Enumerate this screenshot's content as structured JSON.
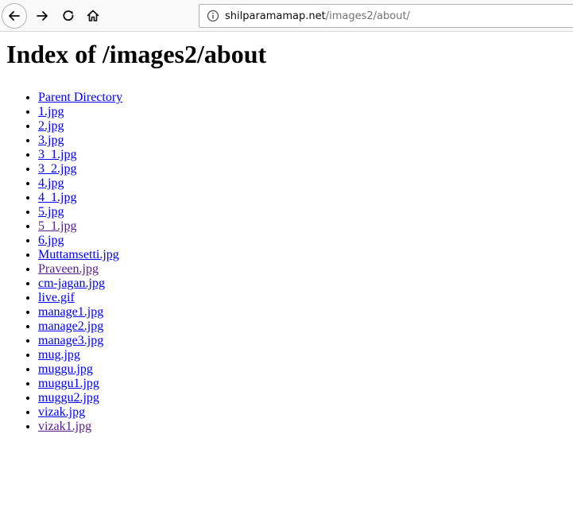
{
  "browser": {
    "url_host": "shilparamamap.net",
    "url_path": "/images2/about/",
    "icons": {
      "back": "arrow-left-icon",
      "forward": "arrow-right-icon",
      "reload": "reload-icon",
      "home": "home-icon",
      "info": "info-icon"
    }
  },
  "page": {
    "heading": "Index of /images2/about",
    "files": [
      {
        "name": "Parent Directory",
        "visited": false
      },
      {
        "name": "1.jpg",
        "visited": false
      },
      {
        "name": "2.jpg",
        "visited": false
      },
      {
        "name": "3.jpg",
        "visited": false
      },
      {
        "name": "3_1.jpg",
        "visited": false
      },
      {
        "name": "3_2.jpg",
        "visited": false
      },
      {
        "name": "4.jpg",
        "visited": false
      },
      {
        "name": "4_1.jpg",
        "visited": false
      },
      {
        "name": "5.jpg",
        "visited": false
      },
      {
        "name": "5_1.jpg",
        "visited": true
      },
      {
        "name": "6.jpg",
        "visited": false
      },
      {
        "name": "Muttamsetti.jpg",
        "visited": false
      },
      {
        "name": "Praveen.jpg",
        "visited": true
      },
      {
        "name": "cm-jagan.jpg",
        "visited": false
      },
      {
        "name": "live.gif",
        "visited": false
      },
      {
        "name": "manage1.jpg",
        "visited": false
      },
      {
        "name": "manage2.jpg",
        "visited": false
      },
      {
        "name": "manage3.jpg",
        "visited": false
      },
      {
        "name": "mug.jpg",
        "visited": false
      },
      {
        "name": "muggu.jpg",
        "visited": false
      },
      {
        "name": "muggu1.jpg",
        "visited": false
      },
      {
        "name": "muggu2.jpg",
        "visited": false
      },
      {
        "name": "vizak.jpg",
        "visited": false
      },
      {
        "name": "vizak1.jpg",
        "visited": true
      }
    ]
  },
  "colors": {
    "link_unvisited": "#0000ee",
    "link_visited": "#551a8b"
  }
}
